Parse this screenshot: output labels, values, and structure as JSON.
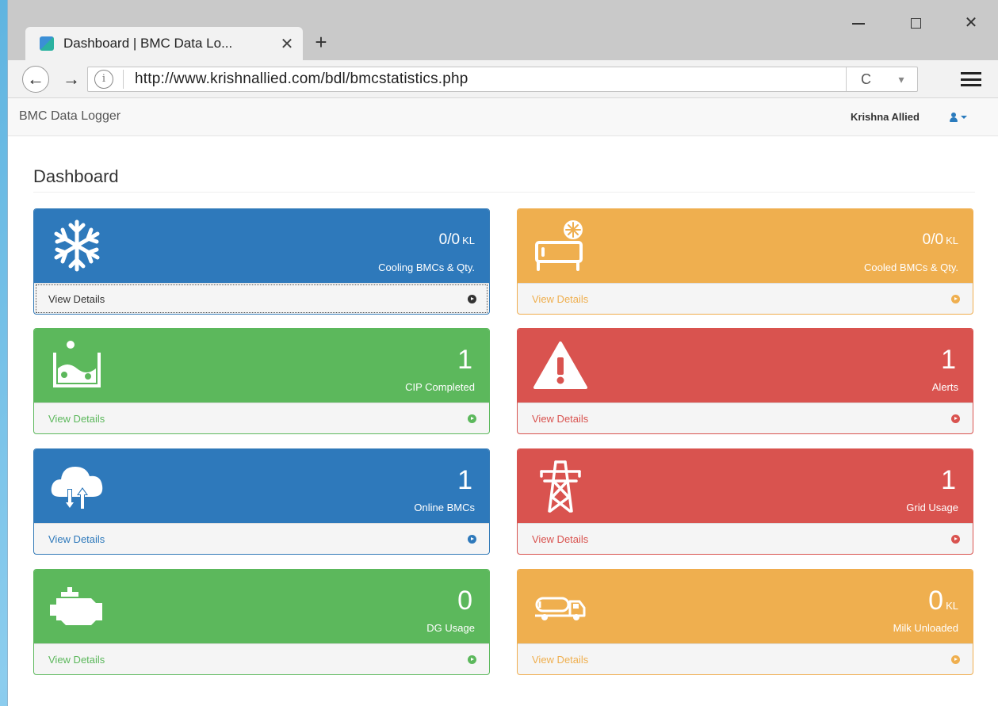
{
  "browser": {
    "tab_title": "Dashboard | BMC Data Lo...",
    "tab_close": "✕",
    "new_tab": "+",
    "url": "http://www.krishnallied.com/bdl/bmcstatistics.php",
    "back": "←",
    "forward": "→",
    "info": "i",
    "reload": "C",
    "pocket": "▾",
    "close": "✕"
  },
  "app": {
    "brand": "BMC Data Logger",
    "user": "Krishna Allied",
    "page_title": "Dashboard"
  },
  "panels": [
    {
      "value": "0/0",
      "unit": "KL",
      "label": "Cooling BMCs & Qty.",
      "link": "View Details",
      "color": "#2e79bb",
      "icon": "snowflake-icon"
    },
    {
      "value": "0/0",
      "unit": "KL",
      "label": "Cooled BMCs & Qty.",
      "link": "View Details",
      "color": "#efaf4f",
      "icon": "cooling-tank-icon"
    },
    {
      "value": "1",
      "unit": "",
      "label": "CIP Completed",
      "link": "View Details",
      "color": "#5cb85c",
      "icon": "cip-tank-icon"
    },
    {
      "value": "1",
      "unit": "",
      "label": "Alerts",
      "link": "View Details",
      "color": "#d9534f",
      "icon": "warning-icon"
    },
    {
      "value": "1",
      "unit": "",
      "label": "Online BMCs",
      "link": "View Details",
      "color": "#2e79bb",
      "icon": "cloud-sync-icon"
    },
    {
      "value": "1",
      "unit": "",
      "label": "Grid Usage",
      "link": "View Details",
      "color": "#d9534f",
      "icon": "power-tower-icon"
    },
    {
      "value": "0",
      "unit": "",
      "label": "DG Usage",
      "link": "View Details",
      "color": "#5cb85c",
      "icon": "engine-icon"
    },
    {
      "value": "0",
      "unit": "KL",
      "label": "Milk Unloaded",
      "link": "View Details",
      "color": "#efaf4f",
      "icon": "milk-tanker-icon"
    }
  ]
}
